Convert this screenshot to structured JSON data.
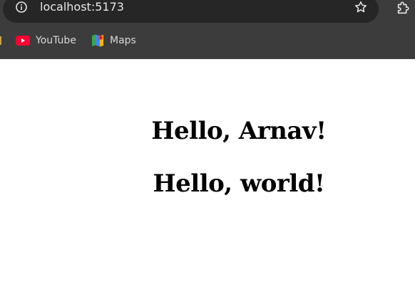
{
  "browser": {
    "url": "localhost:5173",
    "icons": {
      "site_info": "info-icon",
      "bookmark_star": "star-icon",
      "extensions": "puzzle-icon"
    },
    "bookmarks": [
      {
        "label": "YouTube",
        "icon": "youtube-icon"
      },
      {
        "label": "Maps",
        "icon": "maps-icon"
      }
    ]
  },
  "page": {
    "headings": [
      "Hello, Arnav!",
      "Hello, world!"
    ]
  }
}
